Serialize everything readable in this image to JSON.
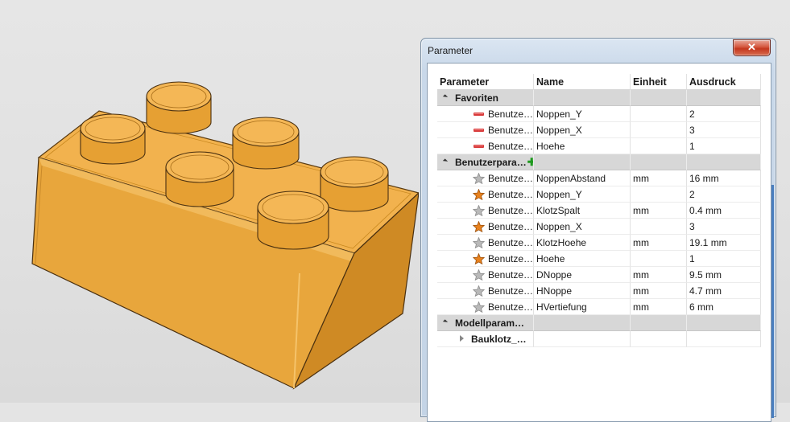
{
  "dialog": {
    "title": "Parameter",
    "close_label": "✕"
  },
  "columns": {
    "parameter": "Parameter",
    "name": "Name",
    "einheit": "Einheit",
    "ausdruck": "Ausdruck"
  },
  "groups": {
    "favoriten": {
      "label": "Favoriten",
      "rows": [
        {
          "param": "Benutze…",
          "name": "Noppen_Y",
          "einheit": "",
          "ausdruck": "2",
          "icon": "favorite-remove-icon"
        },
        {
          "param": "Benutze…",
          "name": "Noppen_X",
          "einheit": "",
          "ausdruck": "3",
          "icon": "favorite-remove-icon"
        },
        {
          "param": "Benutze…",
          "name": "Hoehe",
          "einheit": "",
          "ausdruck": "1",
          "icon": "favorite-remove-icon"
        }
      ]
    },
    "benutzer": {
      "label": "Benutzerpara…",
      "rows": [
        {
          "param": "Benutze…",
          "name": "NoppenAbstand",
          "einheit": "mm",
          "ausdruck": "16 mm",
          "icon": "star-gray-icon"
        },
        {
          "param": "Benutze…",
          "name": "Noppen_Y",
          "einheit": "",
          "ausdruck": "2",
          "icon": "star-orange-icon"
        },
        {
          "param": "Benutze…",
          "name": "KlotzSpalt",
          "einheit": "mm",
          "ausdruck": "0.4 mm",
          "icon": "star-gray-icon"
        },
        {
          "param": "Benutze…",
          "name": "Noppen_X",
          "einheit": "",
          "ausdruck": "3",
          "icon": "star-orange-icon"
        },
        {
          "param": "Benutze…",
          "name": "KlotzHoehe",
          "einheit": "mm",
          "ausdruck": "19.1 mm",
          "icon": "star-gray-icon"
        },
        {
          "param": "Benutze…",
          "name": "Hoehe",
          "einheit": "",
          "ausdruck": "1",
          "icon": "star-orange-icon"
        },
        {
          "param": "Benutze…",
          "name": "DNoppe",
          "einheit": "mm",
          "ausdruck": "9.5 mm",
          "icon": "star-gray-icon"
        },
        {
          "param": "Benutze…",
          "name": "HNoppe",
          "einheit": "mm",
          "ausdruck": "4.7 mm",
          "icon": "star-gray-icon"
        },
        {
          "param": "Benutze…",
          "name": "HVertiefung",
          "einheit": "mm",
          "ausdruck": "6 mm",
          "icon": "star-gray-icon"
        }
      ]
    },
    "modell": {
      "label": "Modellparam…",
      "child": "Bauklotz_…"
    }
  },
  "colors": {
    "brick_top": "#f2b24e",
    "brick_front": "#e8a63c",
    "brick_side": "#cf8a24",
    "star_orange": "#e8821e",
    "star_gray": "#b9b9b9",
    "remove_red": "#d83a3a",
    "scroll_accent": "#4a7fbf"
  }
}
